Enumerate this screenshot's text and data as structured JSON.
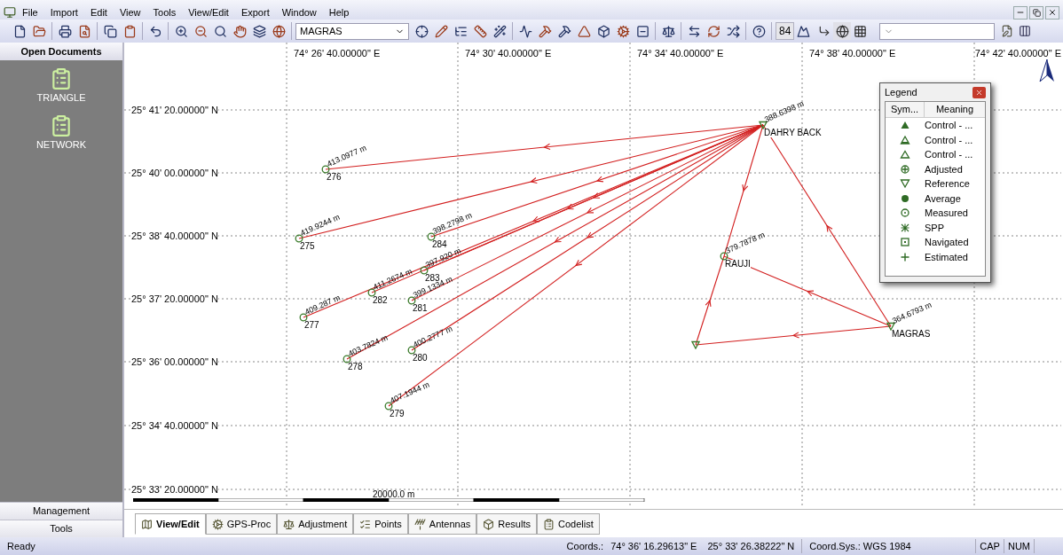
{
  "menu": [
    "File",
    "Import",
    "Edit",
    "View",
    "Tools",
    "View/Edit",
    "Export",
    "Window",
    "Help"
  ],
  "toolbar": {
    "layer_select": "MAGRAS",
    "system_button": "84"
  },
  "sidebar": {
    "title": "Open Documents",
    "documents": [
      {
        "label": "TRIANGLE"
      },
      {
        "label": "NETWORK"
      }
    ],
    "buttons": [
      "Management",
      "Tools"
    ]
  },
  "map": {
    "longitudes": [
      "74° 26' 40.00000\" E",
      "74° 30' 40.00000\" E",
      "74° 34' 40.00000\" E",
      "74° 38' 40.00000\" E",
      "74° 42' 40.00000\" E"
    ],
    "latitudes": [
      "25° 41' 20.00000\" N",
      "25° 40' 00.00000\" N",
      "25° 38' 40.00000\" N",
      "25° 37' 20.00000\" N",
      "25° 36' 00.00000\" N",
      "25° 34' 40.00000\" N",
      "25° 33' 20.00000\" N"
    ],
    "points": [
      {
        "name": "DAHRY BACK",
        "distance": "388.6398 m",
        "kind": "reference"
      },
      {
        "name": "276",
        "distance": "413.0977 m",
        "kind": "measured"
      },
      {
        "name": "275",
        "distance": "419.9244 m",
        "kind": "measured"
      },
      {
        "name": "284",
        "distance": "398.2798 m",
        "kind": "measured"
      },
      {
        "name": "RAUJI",
        "distance": "379.7878 m",
        "kind": "measured"
      },
      {
        "name": "283",
        "distance": "397.920 m",
        "kind": "measured"
      },
      {
        "name": "282",
        "distance": "411.2674 m",
        "kind": "measured"
      },
      {
        "name": "281",
        "distance": "399.1334 m",
        "kind": "measured"
      },
      {
        "name": "277",
        "distance": "409.287 m",
        "kind": "measured"
      },
      {
        "name": "MAGRAS",
        "distance": "364.6793 m",
        "kind": "reference"
      },
      {
        "kind": "reference"
      },
      {
        "name": "280",
        "distance": "400.2777 m",
        "kind": "measured"
      },
      {
        "name": "278",
        "distance": "403.7824 m",
        "kind": "measured"
      },
      {
        "name": "279",
        "distance": "407.1944 m",
        "kind": "measured"
      }
    ],
    "scale": "20000.0 m"
  },
  "legend": {
    "title": "Legend",
    "columns": [
      "Sym...",
      "Meaning"
    ],
    "rows": [
      {
        "kind": "control-filled",
        "meaning": "Control - ..."
      },
      {
        "kind": "control-half",
        "meaning": "Control - ..."
      },
      {
        "kind": "control-outline",
        "meaning": "Control - ..."
      },
      {
        "kind": "adjusted",
        "meaning": "Adjusted"
      },
      {
        "kind": "reference",
        "meaning": "Reference"
      },
      {
        "kind": "average",
        "meaning": "Average"
      },
      {
        "kind": "measured",
        "meaning": "Measured"
      },
      {
        "kind": "spp",
        "meaning": "SPP"
      },
      {
        "kind": "navigated",
        "meaning": "Navigated"
      },
      {
        "kind": "estimated",
        "meaning": "Estimated"
      }
    ]
  },
  "tabs": [
    {
      "label": "View/Edit",
      "selected": true
    },
    {
      "label": "GPS-Proc",
      "selected": false
    },
    {
      "label": "Adjustment",
      "selected": false
    },
    {
      "label": "Points",
      "selected": false
    },
    {
      "label": "Antennas",
      "selected": false
    },
    {
      "label": "Results",
      "selected": false
    },
    {
      "label": "Codelist",
      "selected": false
    }
  ],
  "status_bar": {
    "message": "Ready",
    "coords_label": "Coords.:",
    "longitude": "74° 36' 16.29613\" E",
    "latitude": "25° 33' 26.38222\" N",
    "coord_sys": "Coord.Sys.: WGS 1984",
    "indicators": [
      "CAP",
      "NUM"
    ]
  }
}
